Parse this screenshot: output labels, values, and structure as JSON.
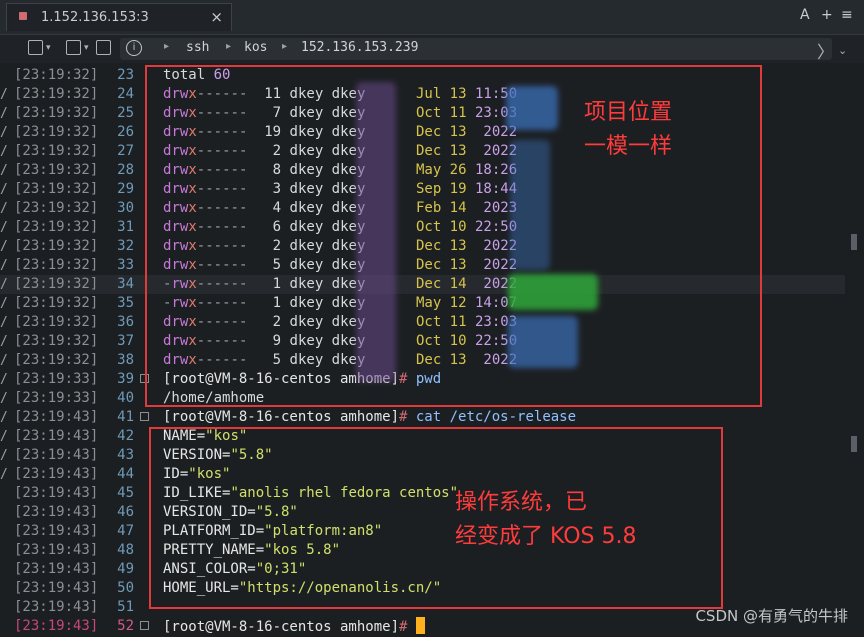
{
  "tab": {
    "title": "1.152.136.153:3",
    "close": "×"
  },
  "tabbar_controls": {
    "font": "A",
    "add": "+",
    "menu": "≡"
  },
  "breadcrumb": {
    "items": [
      "ssh",
      "kos",
      "152.136.153.239"
    ],
    "info": "i",
    "forward": "〉",
    "dropdown": "⌄"
  },
  "colors": {
    "accent_red": "#e03a3a",
    "cursor": "#ffb21e",
    "prompt_hash": "#d06b72"
  },
  "lines": [
    {
      "ts": "[23:19:32]",
      "ln": "23",
      "text": "total 60"
    },
    {
      "ts": "[23:19:32]",
      "ln": "24",
      "perm": "drwx------",
      "links": "11",
      "user": "dkey dkey",
      "month": "Jul 13",
      "time": "11:50"
    },
    {
      "ts": "[23:19:32]",
      "ln": "25",
      "perm": "drwx------",
      "links": "7",
      "user": "dkey dkey",
      "month": "Oct 11",
      "time": "23:03"
    },
    {
      "ts": "[23:19:32]",
      "ln": "26",
      "perm": "drwx------",
      "links": "19",
      "user": "dkey dkey",
      "month": "Dec 13",
      "time": "2022"
    },
    {
      "ts": "[23:19:32]",
      "ln": "27",
      "perm": "drwx------",
      "links": "2",
      "user": "dkey dkey",
      "month": "Dec 13",
      "time": "2022"
    },
    {
      "ts": "[23:19:32]",
      "ln": "28",
      "perm": "drwx------",
      "links": "8",
      "user": "dkey dkey",
      "month": "May 26",
      "time": "18:26"
    },
    {
      "ts": "[23:19:32]",
      "ln": "29",
      "perm": "drwx------",
      "links": "3",
      "user": "dkey dkey",
      "month": "Sep 19",
      "time": "18:44"
    },
    {
      "ts": "[23:19:32]",
      "ln": "30",
      "perm": "drwx------",
      "links": "4",
      "user": "dkey dkey",
      "month": "Feb 14",
      "time": "2023"
    },
    {
      "ts": "[23:19:32]",
      "ln": "31",
      "perm": "drwx------",
      "links": "6",
      "user": "dkey dkey",
      "month": "Oct 10",
      "time": "22:50"
    },
    {
      "ts": "[23:19:32]",
      "ln": "32",
      "perm": "drwx------",
      "links": "2",
      "user": "dkey dkey",
      "month": "Dec 13",
      "time": "2022"
    },
    {
      "ts": "[23:19:32]",
      "ln": "33",
      "perm": "drwx------",
      "links": "5",
      "user": "dkey dkey",
      "month": "Dec 13",
      "time": "2022"
    },
    {
      "ts": "[23:19:32]",
      "ln": "34",
      "perm": "-rwx------",
      "links": "1",
      "user": "dkey dkey",
      "month": "Dec 14",
      "time": "2022"
    },
    {
      "ts": "[23:19:32]",
      "ln": "35",
      "perm": "-rwx------",
      "links": "1",
      "user": "dkey dkey",
      "month": "May 12",
      "time": "14:07"
    },
    {
      "ts": "[23:19:32]",
      "ln": "36",
      "perm": "drwx------",
      "links": "2",
      "user": "dkey dkey",
      "month": "Oct 11",
      "time": "23:03"
    },
    {
      "ts": "[23:19:32]",
      "ln": "37",
      "perm": "drwx------",
      "links": "9",
      "user": "dkey dkey",
      "month": "Oct 10",
      "time": "22:50"
    },
    {
      "ts": "[23:19:32]",
      "ln": "38",
      "perm": "drwx------",
      "links": "5",
      "user": "dkey dkey",
      "month": "Dec 13",
      "time": "2022"
    },
    {
      "ts": "[23:19:33]",
      "ln": "39",
      "prompt": "[root@VM-8-16-centos amhome]",
      "hash": "#",
      "cmd": " pwd"
    },
    {
      "ts": "[23:19:33]",
      "ln": "40",
      "text": "/home/amhome"
    },
    {
      "ts": "[23:19:43]",
      "ln": "41",
      "prompt": "[root@VM-8-16-centos amhome]",
      "hash": "#",
      "cmd": " cat /etc/os-release"
    },
    {
      "ts": "[23:19:43]",
      "ln": "42",
      "key": "NAME=",
      "val": "\"kos\""
    },
    {
      "ts": "[23:19:43]",
      "ln": "43",
      "key": "VERSION=",
      "val": "\"5.8\""
    },
    {
      "ts": "[23:19:43]",
      "ln": "44",
      "key": "ID=",
      "val": "\"kos\""
    },
    {
      "ts": "[23:19:43]",
      "ln": "45",
      "key": "ID_LIKE=",
      "val": "\"anolis rhel fedora centos\""
    },
    {
      "ts": "[23:19:43]",
      "ln": "46",
      "key": "VERSION_ID=",
      "val": "\"5.8\""
    },
    {
      "ts": "[23:19:43]",
      "ln": "47",
      "key": "PLATFORM_ID=",
      "val": "\"platform:an8\""
    },
    {
      "ts": "[23:19:43]",
      "ln": "48",
      "key": "PRETTY_NAME=",
      "val": "\"kos 5.8\""
    },
    {
      "ts": "[23:19:43]",
      "ln": "49",
      "key": "ANSI_COLOR=",
      "val": "\"0;31\""
    },
    {
      "ts": "[23:19:43]",
      "ln": "50",
      "key": "HOME_URL=",
      "val": "\"https://openanolis.cn/\""
    },
    {
      "ts": "[23:19:43]",
      "ln": "51",
      "text": ""
    },
    {
      "ts": "[23:19:43]",
      "ln": "52",
      "prompt": "[root@VM-8-16-centos amhome]",
      "hash": "#",
      "cmd": " ",
      "cursor": true
    }
  ],
  "annotations": {
    "top": "项目位置\n一模一样",
    "bottom": "操作系统，已\n经变成了 KOS 5.8"
  },
  "watermark": "CSDN @有勇气的牛排"
}
